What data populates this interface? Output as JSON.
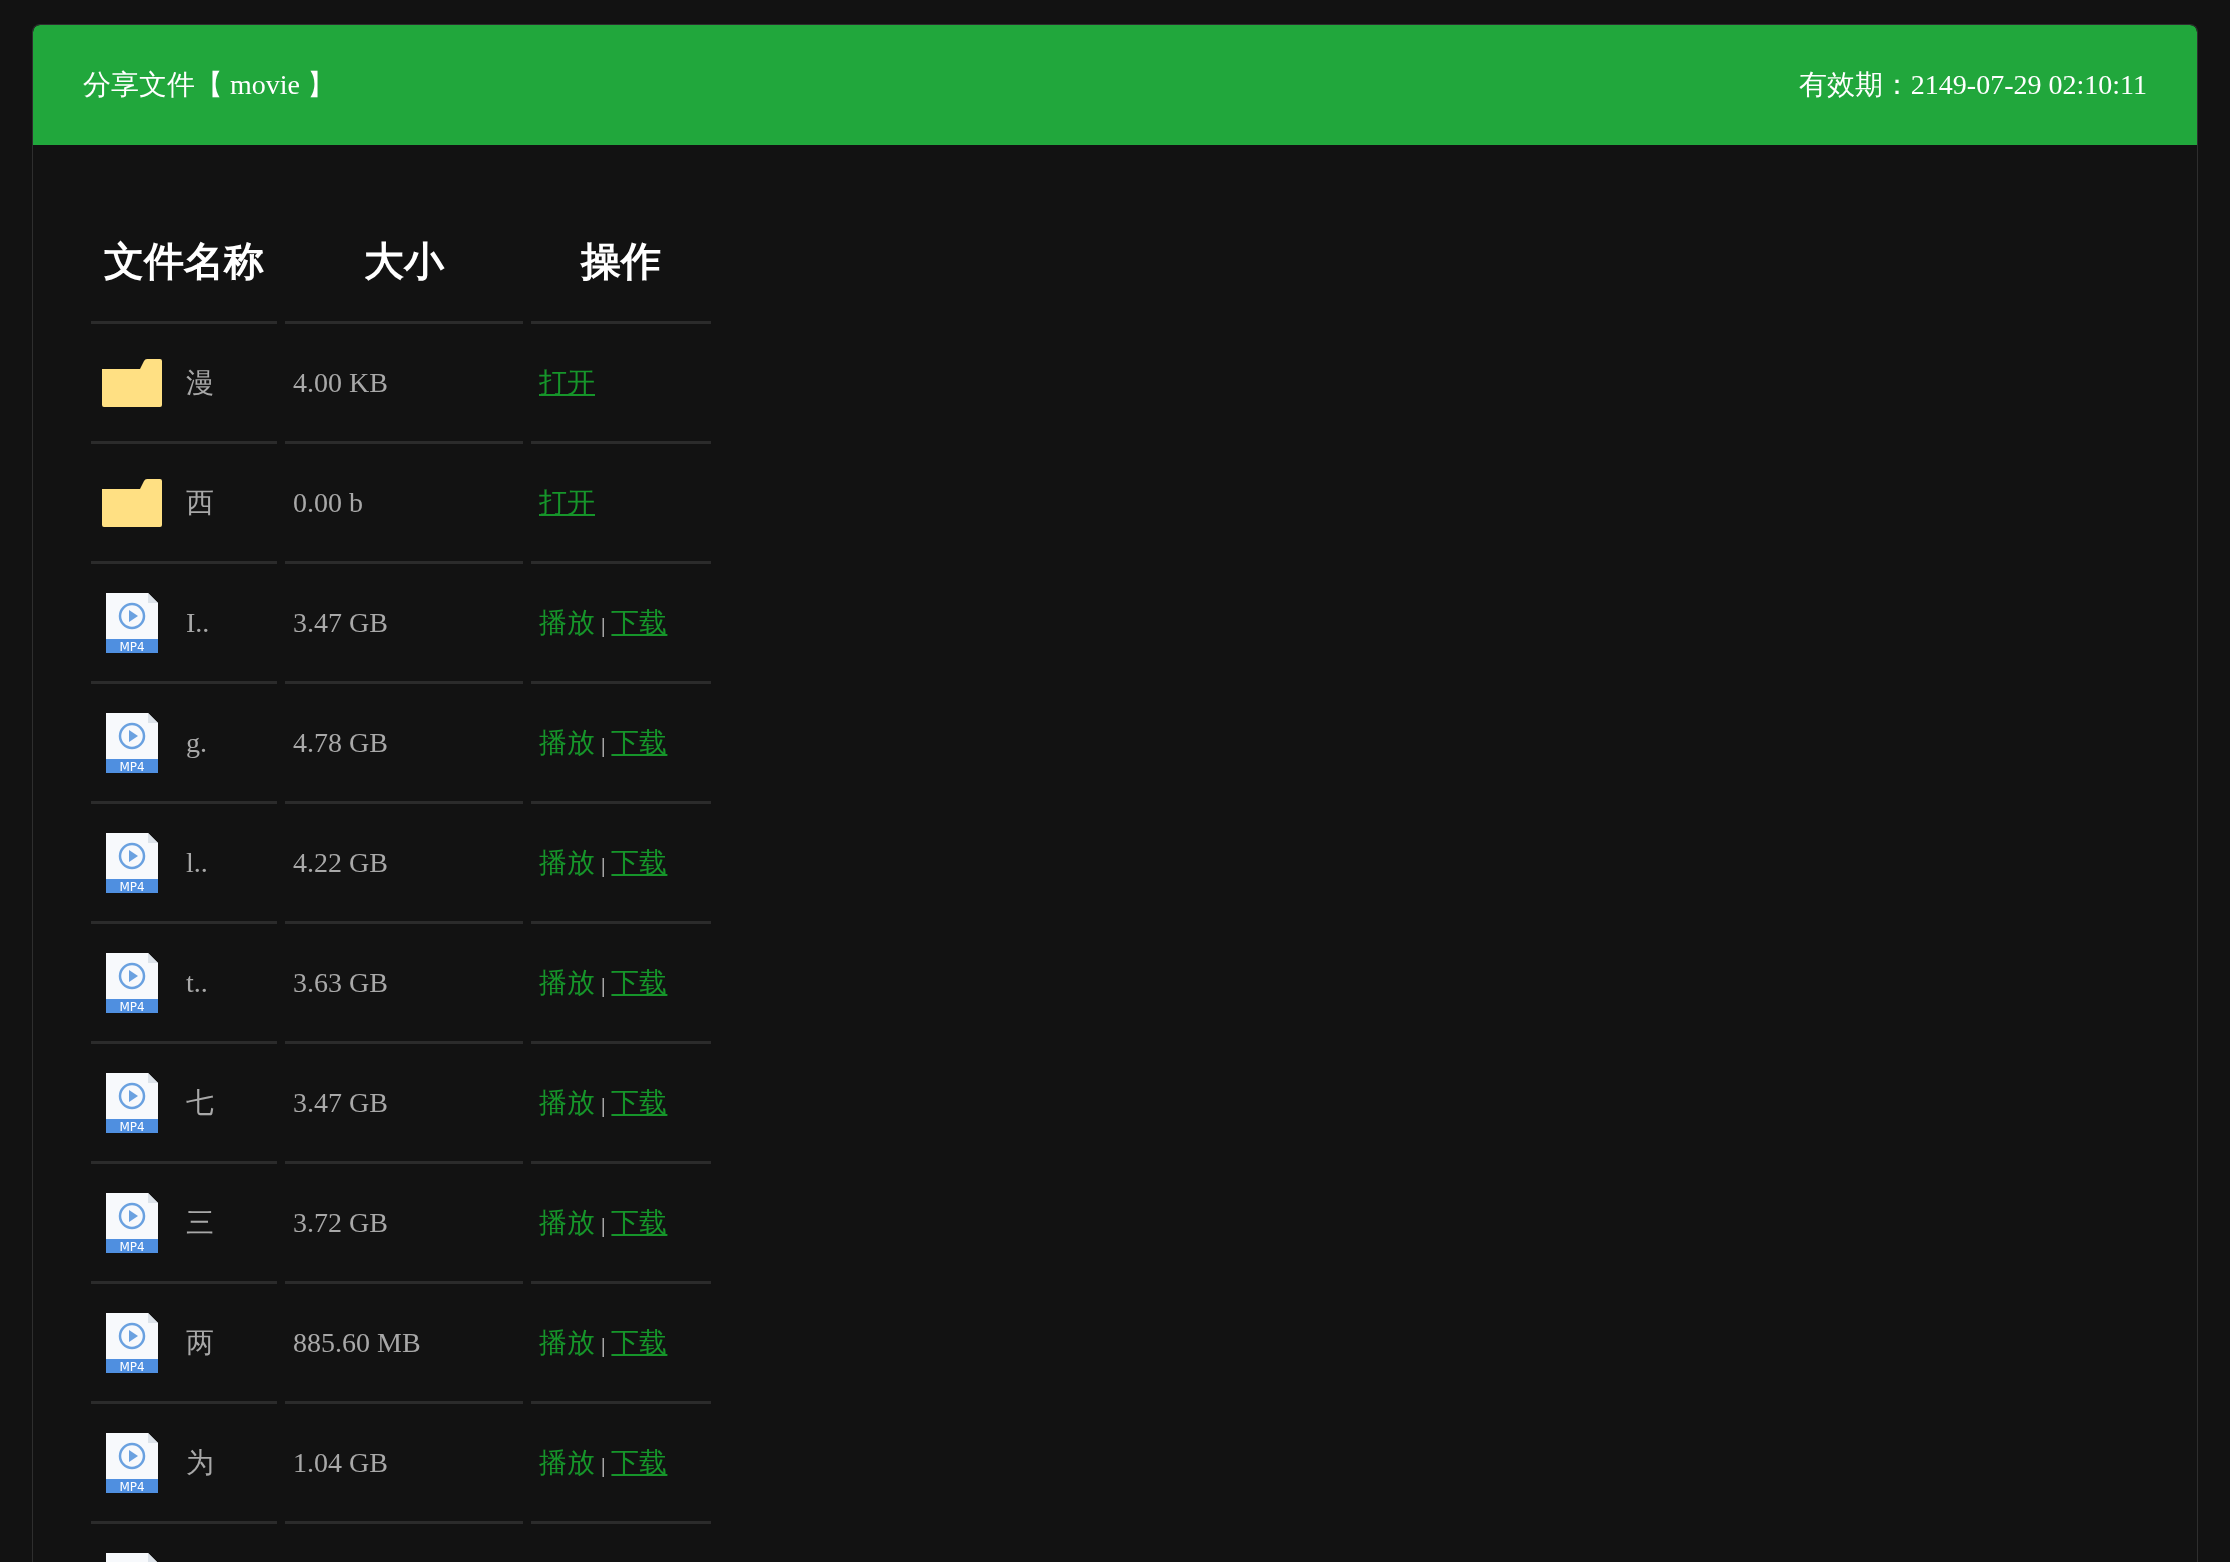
{
  "header": {
    "title": "分享文件【 movie 】",
    "expiry": "有效期：2149-07-29 02:10:11"
  },
  "table": {
    "columns": [
      "文件名称",
      "大小",
      "操作"
    ],
    "rows": [
      {
        "kind": "folder",
        "name": "漫",
        "size": "4.00 KB",
        "open": "打开"
      },
      {
        "kind": "folder",
        "name": "西",
        "size": "0.00 b",
        "open": "打开"
      },
      {
        "kind": "video",
        "badge": "MP4",
        "name": "I..",
        "size": "3.47 GB",
        "play": "播放",
        "separator": "|",
        "download": "下载"
      },
      {
        "kind": "video",
        "badge": "MP4",
        "name": "g.",
        "size": "4.78 GB",
        "play": "播放",
        "separator": "|",
        "download": "下载"
      },
      {
        "kind": "video",
        "badge": "MP4",
        "name": "l..",
        "size": "4.22 GB",
        "play": "播放",
        "separator": "|",
        "download": "下载"
      },
      {
        "kind": "video",
        "badge": "MP4",
        "name": "t..",
        "size": "3.63 GB",
        "play": "播放",
        "separator": "|",
        "download": "下载"
      },
      {
        "kind": "video",
        "badge": "MP4",
        "name": "七",
        "size": "3.47 GB",
        "play": "播放",
        "separator": "|",
        "download": "下载"
      },
      {
        "kind": "video",
        "badge": "MP4",
        "name": "三",
        "size": "3.72 GB",
        "play": "播放",
        "separator": "|",
        "download": "下载"
      },
      {
        "kind": "video",
        "badge": "MP4",
        "name": "两",
        "size": "885.60 MB",
        "play": "播放",
        "separator": "|",
        "download": "下载"
      },
      {
        "kind": "video",
        "badge": "MP4",
        "name": "为",
        "size": "1.04 GB",
        "play": "播放",
        "separator": "|",
        "download": "下载"
      },
      {
        "kind": "video"
      }
    ]
  }
}
